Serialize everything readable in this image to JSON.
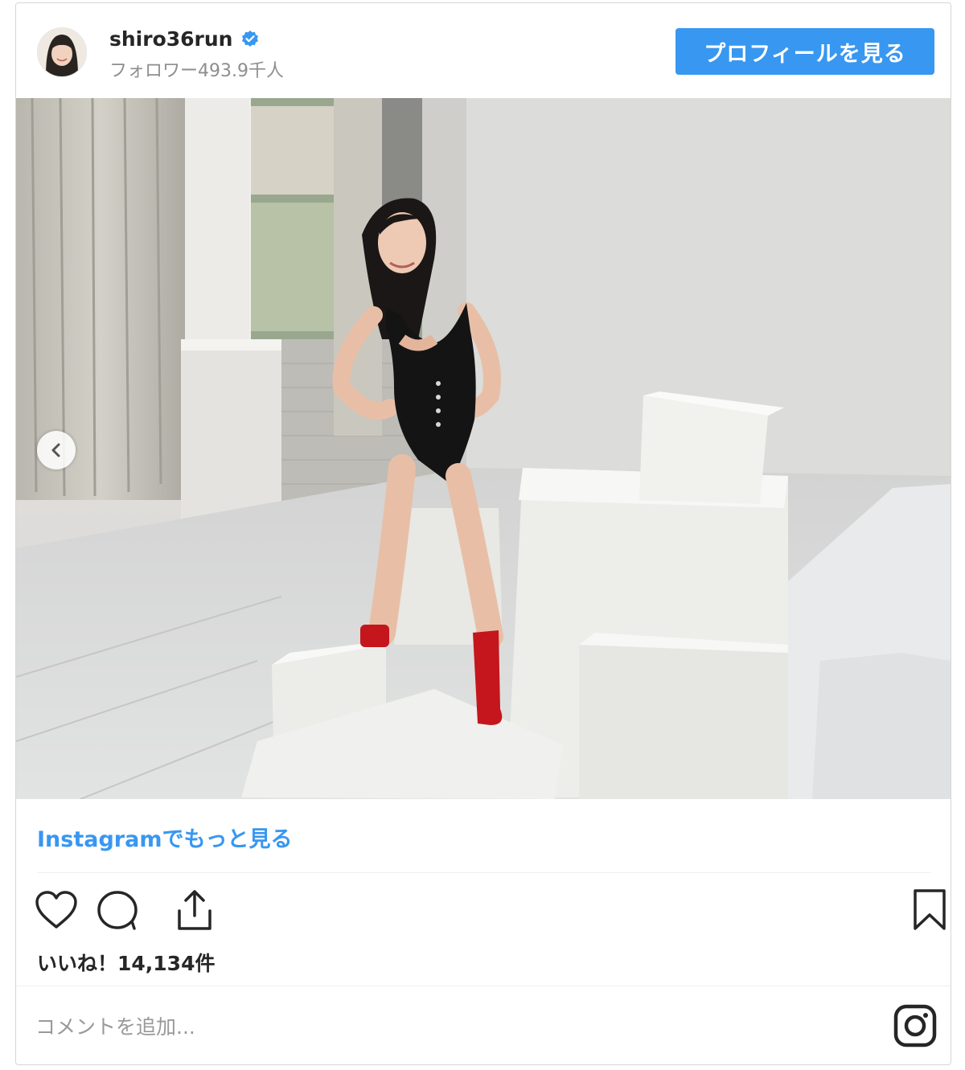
{
  "post": {
    "username": "shiro36run",
    "followers_text": "フォロワー493.9千人",
    "profile_button": "プロフィールを見る",
    "more_link": "Instagramでもっと見る",
    "likes_text": "いいね！14,134件",
    "comment_placeholder": "コメントを追加...",
    "verified": true
  },
  "icons": {
    "verified": "verified-badge-icon",
    "prev": "chevron-left-icon",
    "like": "heart-icon",
    "comment": "comment-bubble-icon",
    "share": "share-icon",
    "save": "bookmark-icon",
    "logo": "instagram-logo-icon"
  },
  "colors": {
    "accent": "#3897f0",
    "text": "#262626",
    "muted": "#8e8e8e",
    "border": "#d6d6d6"
  }
}
